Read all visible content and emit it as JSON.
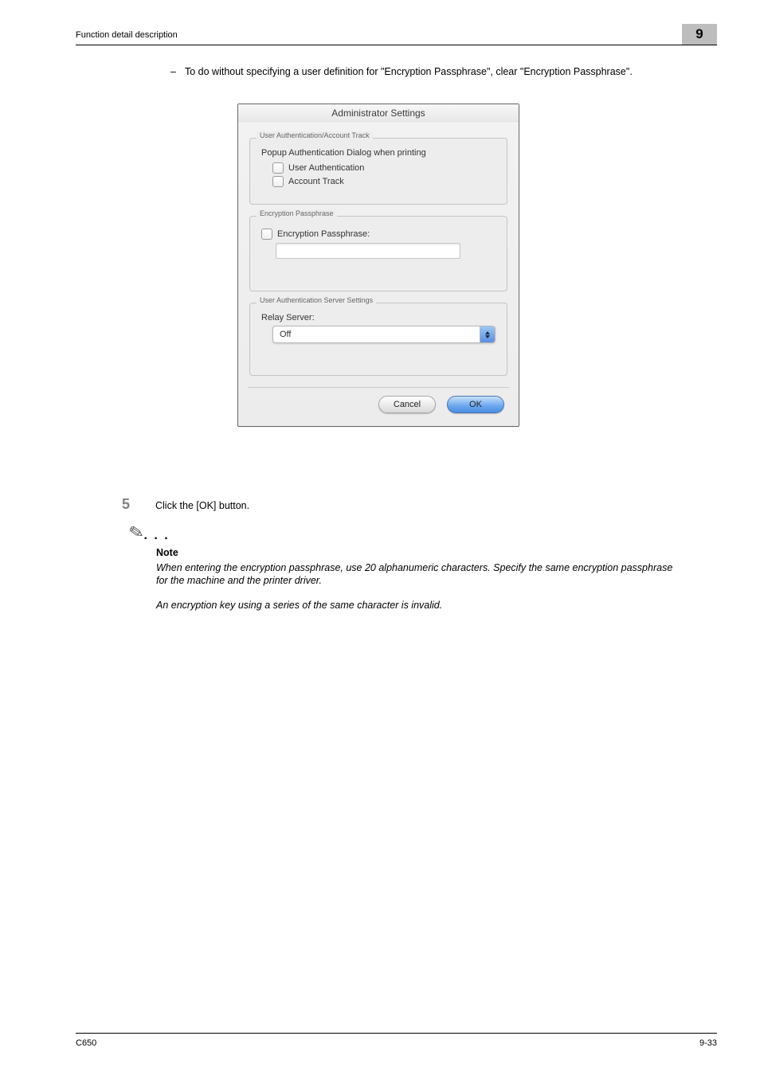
{
  "header": {
    "running_head": "Function detail description",
    "chapter": "9"
  },
  "intro": {
    "bullet_text": "To do without specifying a user definition for \"Encryption Passphrase\", clear \"Encryption Passphrase\"."
  },
  "dialog": {
    "title": "Administrator Settings",
    "group1": {
      "legend": "User Authentication/Account Track",
      "header": "Popup Authentication Dialog when printing",
      "opt1": "User Authentication",
      "opt2": "Account Track"
    },
    "group2": {
      "legend": "Encryption Passphrase",
      "label": "Encryption Passphrase:"
    },
    "group3": {
      "legend": "User Authentication Server Settings",
      "label": "Relay Server:",
      "value": "Off"
    },
    "buttons": {
      "cancel": "Cancel",
      "ok": "OK"
    }
  },
  "step5": {
    "num": "5",
    "text": "Click the [OK] button."
  },
  "note": {
    "title": "Note",
    "body1": "When entering the encryption passphrase, use 20 alphanumeric characters. Specify the same encryption passphrase for the machine and the printer driver.",
    "body2": "An encryption key using a series of the same character is invalid."
  },
  "footer": {
    "left": "C650",
    "right": "9-33"
  }
}
